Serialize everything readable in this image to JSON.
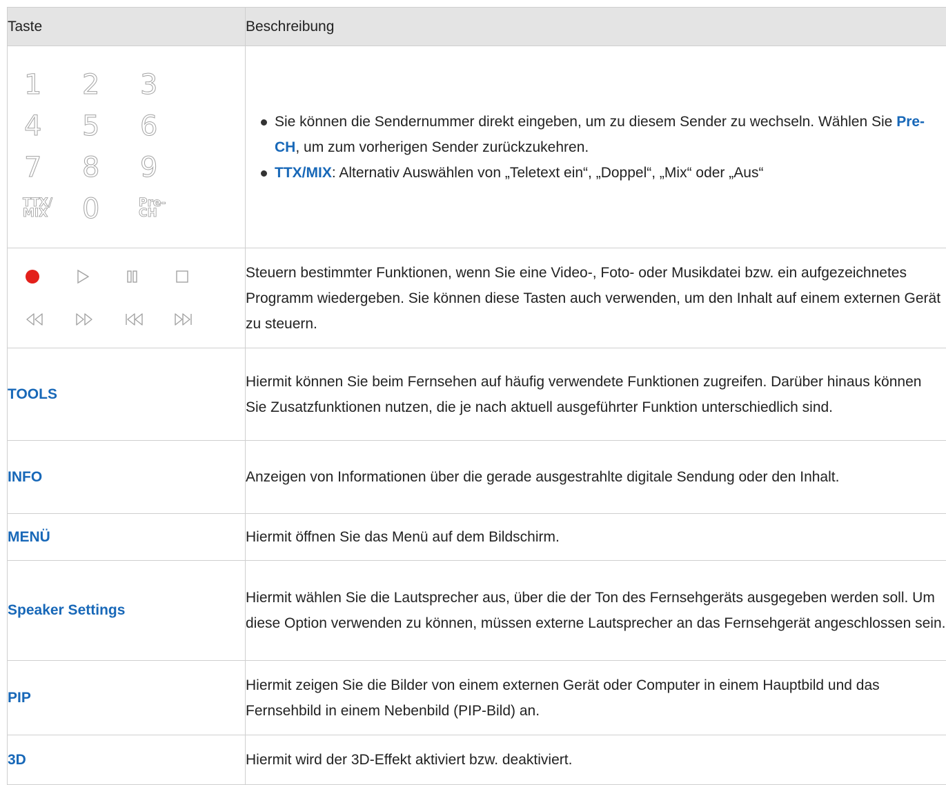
{
  "header": {
    "col1": "Taste",
    "col2": "Beschreibung"
  },
  "numpad": {
    "keys": [
      "1",
      "2",
      "3",
      "4",
      "5",
      "6",
      "7",
      "8",
      "9"
    ],
    "ttx_key": [
      "TTX/",
      "MIX"
    ],
    "zero_key": "0",
    "prech_key": [
      "Pre-",
      "CH"
    ]
  },
  "row_numpad": {
    "b1_text": "Sie können die Sendernummer direkt eingeben, um zu diesem Sender zu wechseln. Wählen Sie ",
    "b1_kw": "Pre-CH",
    "b1_tail": ", um zum vorherigen Sender zurückzukehren.",
    "b2_kw": "TTX/MIX",
    "b2_text": ": Alternativ Auswählen von „Teletext ein“, „Doppel“, „Mix“ oder „Aus“"
  },
  "media_icons": [
    "record-icon",
    "play-icon",
    "pause-icon",
    "stop-icon",
    "rewind-icon",
    "fast-forward-icon",
    "previous-icon",
    "next-icon"
  ],
  "row_media": {
    "desc": "Steuern bestimmter Funktionen, wenn Sie eine Video-, Foto- oder Musikdatei bzw. ein aufgezeichnetes Programm wiedergeben. Sie können diese Tasten auch verwenden, um den Inhalt auf einem externen Gerät zu steuern."
  },
  "rows": [
    {
      "key": "TOOLS",
      "desc": "Hiermit können Sie beim Fernsehen auf häufig verwendete Funktionen zugreifen. Darüber hinaus können Sie Zusatzfunktionen nutzen, die je nach aktuell ausgeführter Funktion unterschiedlich sind."
    },
    {
      "key": "INFO",
      "desc": "Anzeigen von Informationen über die gerade ausgestrahlte digitale Sendung oder den Inhalt."
    },
    {
      "key": "MENÜ",
      "desc": "Hiermit öffnen Sie das Menü auf dem Bildschirm."
    },
    {
      "key": "Speaker Settings",
      "desc": "Hiermit wählen Sie die Lautsprecher aus, über die der Ton des Fernsehgeräts ausgegeben werden soll. Um diese Option verwenden zu können, müssen externe Lautsprecher an das Fernsehgerät angeschlossen sein."
    },
    {
      "key": "PIP",
      "desc": "Hiermit zeigen Sie die Bilder von einem externen Gerät oder Computer in einem Hauptbild und das Fernsehbild in einem Nebenbild (PIP-Bild) an."
    },
    {
      "key": "3D",
      "desc": "Hiermit wird der 3D-Effekt aktiviert bzw. deaktiviert."
    }
  ],
  "colors": {
    "keyword": "#1868b8",
    "header_bg": "#e4e4e4",
    "border": "#cfcfcf",
    "record": "#e3201b"
  }
}
